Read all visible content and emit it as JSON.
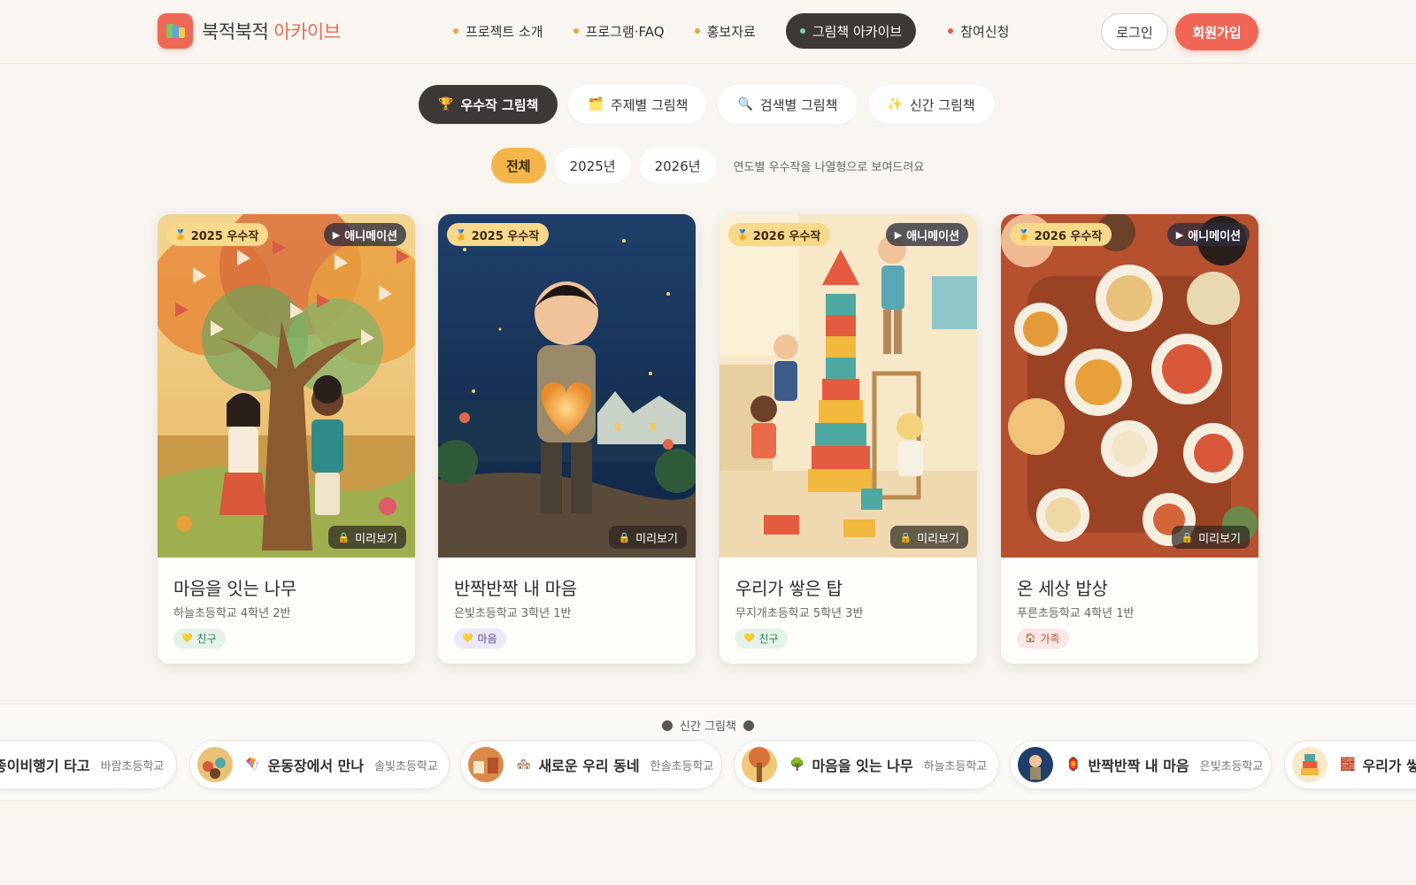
{
  "header": {
    "logo_text": "북적북적",
    "logo_accent": "아카이브",
    "nav": [
      {
        "label": "프로젝트 소개"
      },
      {
        "label": "프로그램·FAQ"
      },
      {
        "label": "홍보자료"
      },
      {
        "label": "그림책 아카이브"
      },
      {
        "label": "참여신청"
      }
    ],
    "login_label": "로그인",
    "signup_label": "회원가입"
  },
  "category_tabs": [
    {
      "icon": "🏆",
      "label": "우수작 그림책"
    },
    {
      "icon": "🗂️",
      "label": "주제별 그림책"
    },
    {
      "icon": "🔍",
      "label": "검색별 그림책"
    },
    {
      "icon": "✨",
      "label": "신간 그림책"
    }
  ],
  "year_filters": {
    "options": [
      "전체",
      "2025년",
      "2026년"
    ],
    "selected": "전체",
    "hint": "연도별 우수작을 나열형으로 보여드려요"
  },
  "cards": [
    {
      "year_badge": "2025 우수작",
      "anim_badge": "애니메이션",
      "preview_label": "미리보기",
      "title": "마음을 잇는 나무",
      "school": "하늘초등학교 4학년 2반",
      "tag": "친구",
      "tag_icon": "💛"
    },
    {
      "year_badge": "2025 우수작",
      "anim_badge": "",
      "preview_label": "미리보기",
      "title": "반짝반짝 내 마음",
      "school": "은빛초등학교 3학년 1반",
      "tag": "마음",
      "tag_icon": "💛"
    },
    {
      "year_badge": "2026 우수작",
      "anim_badge": "애니메이션",
      "preview_label": "미리보기",
      "title": "우리가 쌓은 탑",
      "school": "무지개초등학교 5학년 3반",
      "tag": "친구",
      "tag_icon": "💛"
    },
    {
      "year_badge": "2026 우수작",
      "anim_badge": "애니메이션",
      "preview_label": "미리보기",
      "title": "온 세상 밥상",
      "school": "푸른초등학교 4학년 1반",
      "tag": "가족",
      "tag_icon": "🏠"
    }
  ],
  "new_books": {
    "title": "신간 그림책",
    "items": [
      {
        "icon": "",
        "title": "종이비행기 타고",
        "school": "바람초등학교"
      },
      {
        "icon": "🪁",
        "title": "운동장에서 만나",
        "school": "솔빛초등학교"
      },
      {
        "icon": "🏘️",
        "title": "새로운 우리 동네",
        "school": "한솔초등학교"
      },
      {
        "icon": "🌳",
        "title": "마음을 잇는 나무",
        "school": "하늘초등학교"
      },
      {
        "icon": "🏮",
        "title": "반짝반짝 내 마음",
        "school": "은빛초등학교"
      },
      {
        "icon": "🧱",
        "title": "우리가 쌓은",
        "school": ""
      }
    ]
  }
}
